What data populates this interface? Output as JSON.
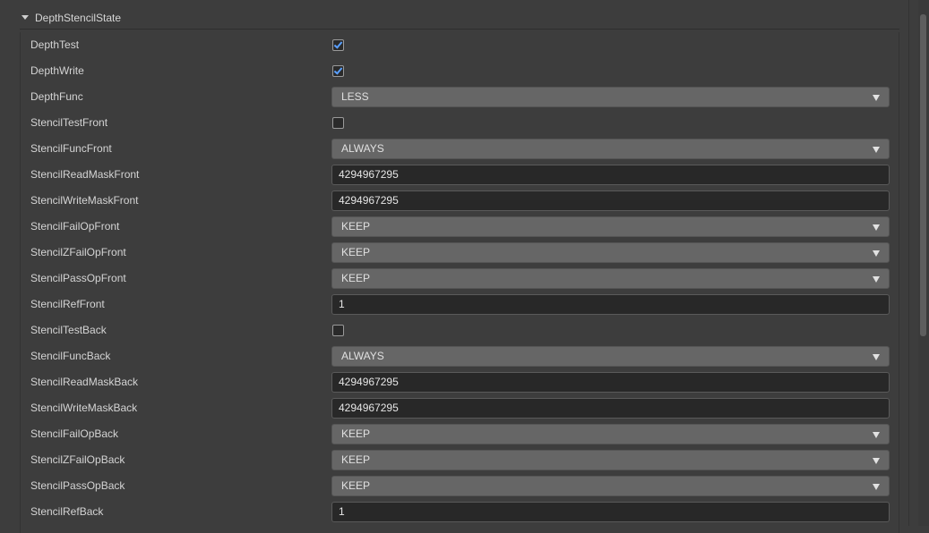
{
  "section": {
    "title": "DepthStencilState",
    "expanded": true
  },
  "rows": [
    {
      "label": "DepthTest",
      "kind": "checkbox",
      "checked": true
    },
    {
      "label": "DepthWrite",
      "kind": "checkbox",
      "checked": true
    },
    {
      "label": "DepthFunc",
      "kind": "select",
      "value": "LESS"
    },
    {
      "label": "StencilTestFront",
      "kind": "checkbox",
      "checked": false
    },
    {
      "label": "StencilFuncFront",
      "kind": "select",
      "value": "ALWAYS"
    },
    {
      "label": "StencilReadMaskFront",
      "kind": "input",
      "value": "4294967295"
    },
    {
      "label": "StencilWriteMaskFront",
      "kind": "input",
      "value": "4294967295"
    },
    {
      "label": "StencilFailOpFront",
      "kind": "select",
      "value": "KEEP"
    },
    {
      "label": "StencilZFailOpFront",
      "kind": "select",
      "value": "KEEP"
    },
    {
      "label": "StencilPassOpFront",
      "kind": "select",
      "value": "KEEP"
    },
    {
      "label": "StencilRefFront",
      "kind": "input",
      "value": "1"
    },
    {
      "label": "StencilTestBack",
      "kind": "checkbox",
      "checked": false
    },
    {
      "label": "StencilFuncBack",
      "kind": "select",
      "value": "ALWAYS"
    },
    {
      "label": "StencilReadMaskBack",
      "kind": "input",
      "value": "4294967295"
    },
    {
      "label": "StencilWriteMaskBack",
      "kind": "input",
      "value": "4294967295"
    },
    {
      "label": "StencilFailOpBack",
      "kind": "select",
      "value": "KEEP"
    },
    {
      "label": "StencilZFailOpBack",
      "kind": "select",
      "value": "KEEP"
    },
    {
      "label": "StencilPassOpBack",
      "kind": "select",
      "value": "KEEP"
    },
    {
      "label": "StencilRefBack",
      "kind": "input",
      "value": "1"
    }
  ],
  "icons": {
    "section_toggle": "caret-down-icon",
    "select_arrow": "chevron-down-icon",
    "check": "checkmark-icon"
  },
  "colors": {
    "background": "#3d3d3d",
    "checkbox_accent": "#5aa0ff",
    "select_bg": "#666666",
    "input_bg": "#282828"
  }
}
